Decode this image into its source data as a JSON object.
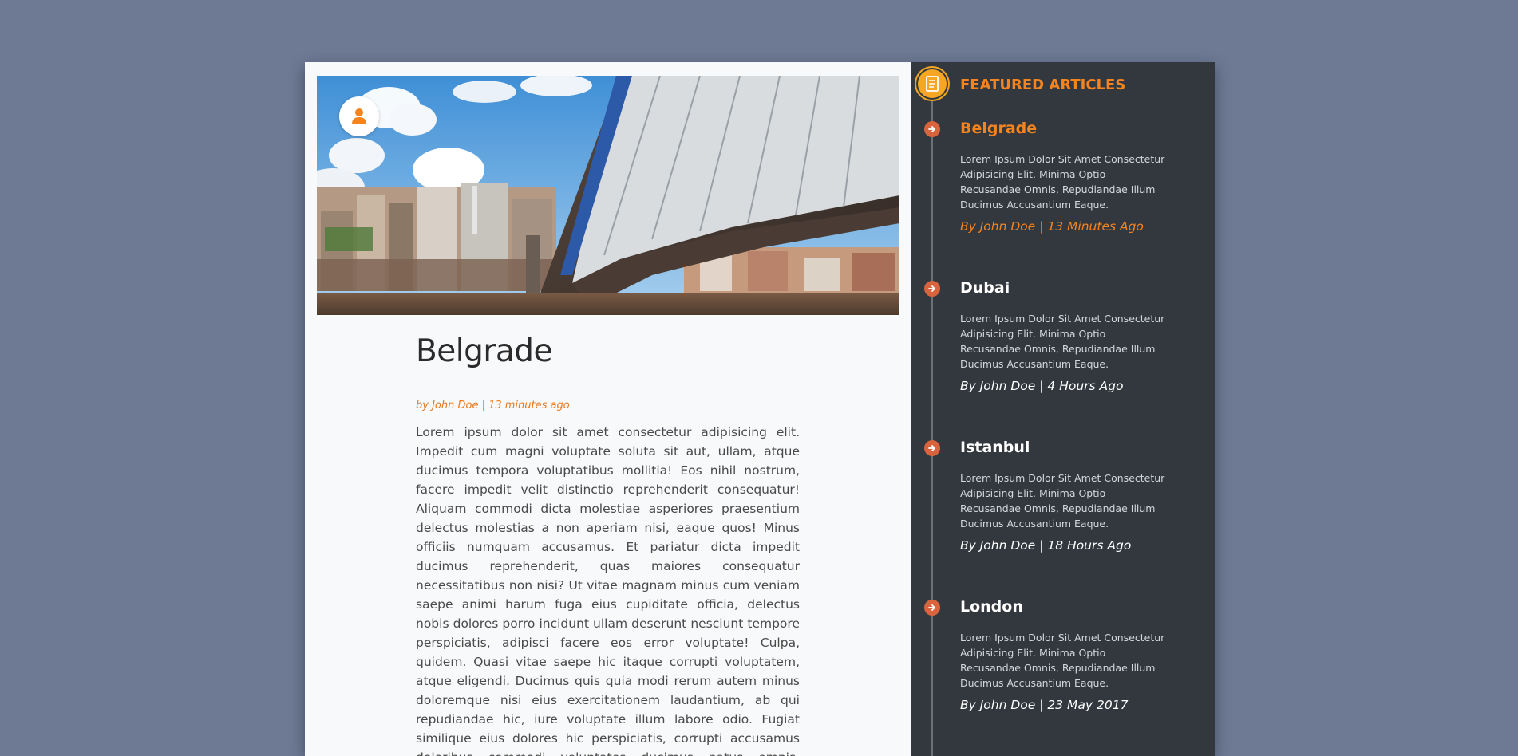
{
  "main": {
    "hero_image_alt": "Bridge over river in Belgrade",
    "avatar_icon": "user-icon",
    "title": "Belgrade",
    "byline": "by John Doe | 13 minutes ago",
    "body": "Lorem ipsum dolor sit amet consectetur adipisicing elit. Impedit cum magni voluptate soluta sit aut, ullam, atque ducimus tempora voluptatibus mollitia! Eos nihil nostrum, facere impedit velit distinctio reprehenderit consequatur! Aliquam commodi dicta molestiae asperiores praesentium delectus molestias a non aperiam nisi, eaque quos! Minus officiis numquam accusamus. Et pariatur dicta impedit ducimus reprehenderit, quas maiores consequatur necessitatibus non nisi? Ut vitae magnam minus cum veniam saepe animi harum fuga eius cupiditate officia, delectus nobis dolores porro incidunt ullam deserunt nesciunt tempore perspiciatis, adipisci facere eos error voluptate! Culpa, quidem. Quasi vitae saepe hic itaque corrupti voluptatem, atque eligendi. Ducimus quis quia modi rerum autem minus doloremque nisi eius exercitationem laudantium, ab qui repudiandae hic, iure voluptate illum labore odio. Fugiat similique eius dolores hic perspiciatis, corrupti accusamus doloribus commodi voluptates ducimus natus omnis, inventore et. Quod"
  },
  "sidebar": {
    "title": "FEATURED ARTICLES",
    "header_icon": "document-icon",
    "entry_icon": "arrow-right-circle-icon",
    "articles": [
      {
        "title": "Belgrade",
        "excerpt": "Lorem Ipsum Dolor Sit Amet Consectetur Adipisicing Elit. Minima Optio Recusandae Omnis, Repudiandae Illum Ducimus Accusantium Eaque.",
        "meta": "By John Doe | 13 Minutes Ago"
      },
      {
        "title": "Dubai",
        "excerpt": "Lorem Ipsum Dolor Sit Amet Consectetur Adipisicing Elit. Minima Optio Recusandae Omnis, Repudiandae Illum Ducimus Accusantium Eaque.",
        "meta": "By John Doe | 4 Hours Ago"
      },
      {
        "title": "Istanbul",
        "excerpt": "Lorem Ipsum Dolor Sit Amet Consectetur Adipisicing Elit. Minima Optio Recusandae Omnis, Repudiandae Illum Ducimus Accusantium Eaque.",
        "meta": "By John Doe | 18 Hours Ago"
      },
      {
        "title": "London",
        "excerpt": "Lorem Ipsum Dolor Sit Amet Consectetur Adipisicing Elit. Minima Optio Recusandae Omnis, Repudiandae Illum Ducimus Accusantium Eaque.",
        "meta": "By John Doe | 23 May 2017"
      }
    ]
  },
  "colors": {
    "background": "#6e7a94",
    "accent": "#f5841f",
    "sidebar_bg": "#33383f",
    "timeline_dot": "#d9633c"
  }
}
